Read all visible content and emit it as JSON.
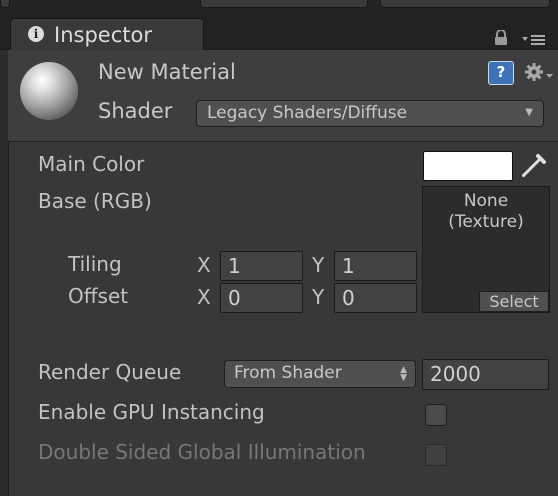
{
  "window": {
    "tab_label": "Inspector"
  },
  "material": {
    "name": "New Material",
    "shader_label": "Shader",
    "shader_value": "Legacy Shaders/Diffuse"
  },
  "properties": {
    "main_color_label": "Main Color",
    "main_color_value": "#ffffff",
    "base_label": "Base (RGB)",
    "texture_none": "None",
    "texture_type": "(Texture)",
    "select_label": "Select",
    "tiling_label": "Tiling",
    "offset_label": "Offset",
    "axis_x": "X",
    "axis_y": "Y",
    "tiling_x": "1",
    "tiling_y": "1",
    "offset_x": "0",
    "offset_y": "0"
  },
  "advanced": {
    "render_queue_label": "Render Queue",
    "render_queue_mode": "From Shader",
    "render_queue_value": "2000",
    "gpu_instancing_label": "Enable GPU Instancing",
    "gpu_instancing_checked": false,
    "double_sided_gi_label": "Double Sided Global Illumination",
    "double_sided_gi_checked": false
  },
  "icons": {
    "tab": "info-icon",
    "lock": "lock-icon",
    "menu": "tab-menu-icon",
    "help": "help-icon",
    "gear": "gear-icon",
    "eyedropper": "eyedropper-icon"
  },
  "colors": {
    "background": "#383838",
    "header": "#3e3e3e",
    "text": "#c2c2c2",
    "help_blue": "#3f72b6"
  }
}
